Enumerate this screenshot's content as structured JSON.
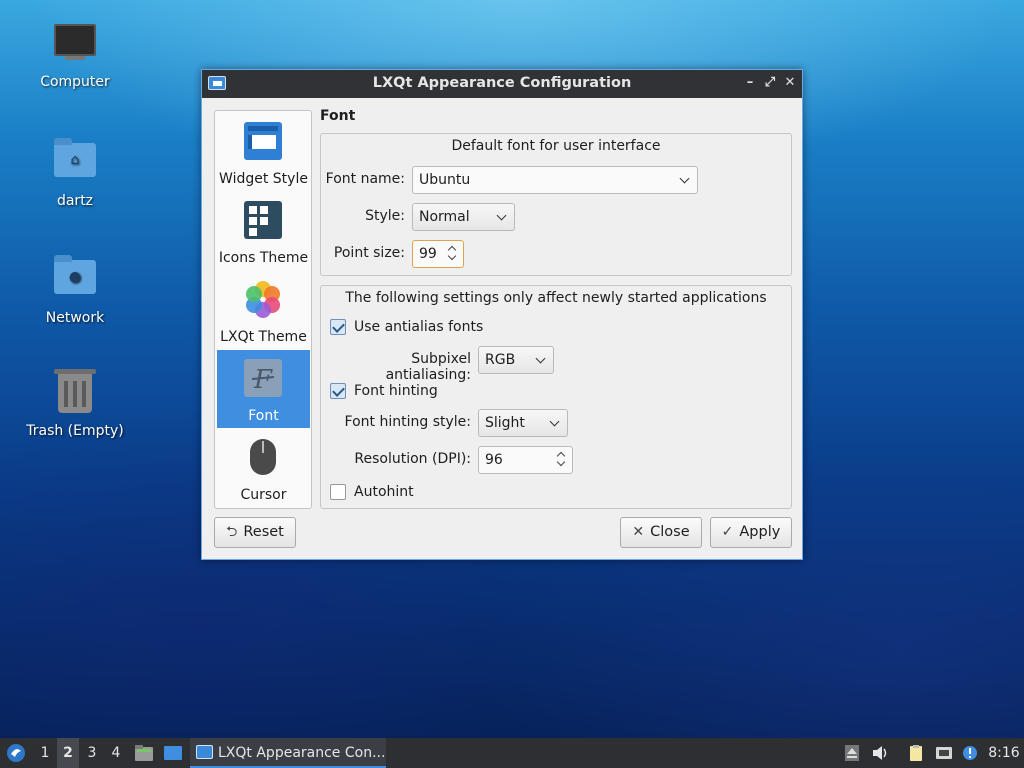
{
  "desktop": {
    "icons": [
      {
        "label": "Computer",
        "icon": "computer-icon"
      },
      {
        "label": "dartz",
        "icon": "home-folder-icon"
      },
      {
        "label": "Network",
        "icon": "network-folder-icon"
      },
      {
        "label": "Trash (Empty)",
        "icon": "trash-icon"
      }
    ]
  },
  "window": {
    "title": "LXQt Appearance Configuration",
    "controls": {
      "minimize": "–",
      "maximize": "⤢",
      "close": "✕"
    },
    "sidebar": [
      {
        "label": "Widget Style",
        "icon": "widget-style-icon",
        "selected": false
      },
      {
        "label": "Icons Theme",
        "icon": "icons-theme-icon",
        "selected": false
      },
      {
        "label": "LXQt Theme",
        "icon": "lxqt-theme-icon",
        "selected": false
      },
      {
        "label": "Font",
        "icon": "font-icon",
        "selected": true
      },
      {
        "label": "Cursor",
        "icon": "cursor-icon",
        "selected": false
      }
    ],
    "section_title": "Font",
    "group1": {
      "title": "Default font for user interface",
      "font_name_label": "Font name:",
      "font_name_value": "Ubuntu",
      "style_label": "Style:",
      "style_value": "Normal",
      "point_size_label": "Point size:",
      "point_size_value": "99"
    },
    "group2": {
      "title": "The following settings only affect newly started applications",
      "antialias_label": "Use antialias fonts",
      "antialias_checked": true,
      "subpixel_label": "Subpixel antialiasing:",
      "subpixel_value": "RGB",
      "hinting_label": "Font hinting",
      "hinting_checked": true,
      "hinting_style_label": "Font hinting style:",
      "hinting_style_value": "Slight",
      "dpi_label": "Resolution (DPI):",
      "dpi_value": "96",
      "autohint_label": "Autohint",
      "autohint_checked": false
    },
    "buttons": {
      "reset": "Reset",
      "close": "Close",
      "apply": "Apply"
    }
  },
  "taskbar": {
    "workspaces": [
      "1",
      "2",
      "3",
      "4"
    ],
    "active_workspace": "2",
    "task_label": "LXQt Appearance Con...",
    "clock": "8:16"
  },
  "colors": {
    "accent": "#3f8ee0",
    "titlebar": "#303235",
    "taskbar": "#2d2f33"
  }
}
